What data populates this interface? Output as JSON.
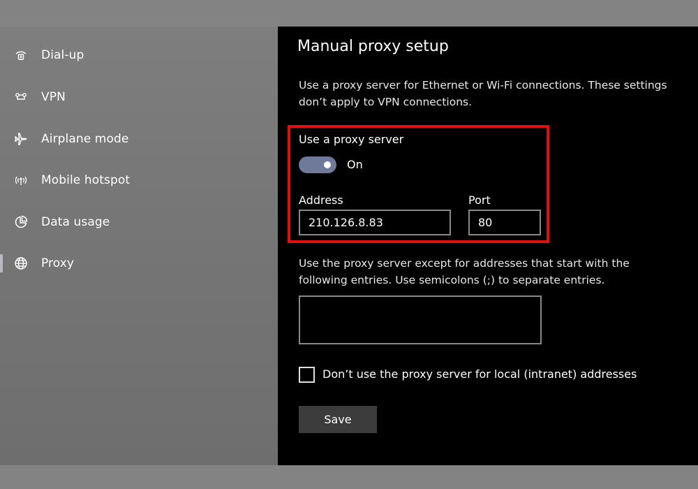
{
  "sidebar": {
    "items": [
      {
        "label": "Dial-up",
        "icon": "dial-up-icon"
      },
      {
        "label": "VPN",
        "icon": "vpn-icon"
      },
      {
        "label": "Airplane mode",
        "icon": "airplane-icon"
      },
      {
        "label": "Mobile hotspot",
        "icon": "hotspot-icon"
      },
      {
        "label": "Data usage",
        "icon": "data-usage-icon"
      },
      {
        "label": "Proxy",
        "icon": "globe-icon",
        "active": true
      }
    ]
  },
  "main": {
    "title": "Manual proxy setup",
    "description": "Use a proxy server for Ethernet or Wi-Fi connections. These settings don’t apply to VPN connections.",
    "use_proxy": {
      "label": "Use a proxy server",
      "state_label": "On",
      "enabled": true
    },
    "address": {
      "label": "Address",
      "value": "210.126.8.83"
    },
    "port": {
      "label": "Port",
      "value": "80"
    },
    "exceptions": {
      "description": "Use the proxy server except for addresses that start with the following entries. Use semicolons (;) to separate entries.",
      "value": ""
    },
    "local_bypass": {
      "label": "Don’t use the proxy server for local (intranet) addresses",
      "checked": false
    },
    "save_label": "Save"
  },
  "colors": {
    "highlight": "#e01010",
    "toggle_on": "#6f7a9a",
    "sidebar_bg": "#767676",
    "main_bg": "#000000"
  }
}
